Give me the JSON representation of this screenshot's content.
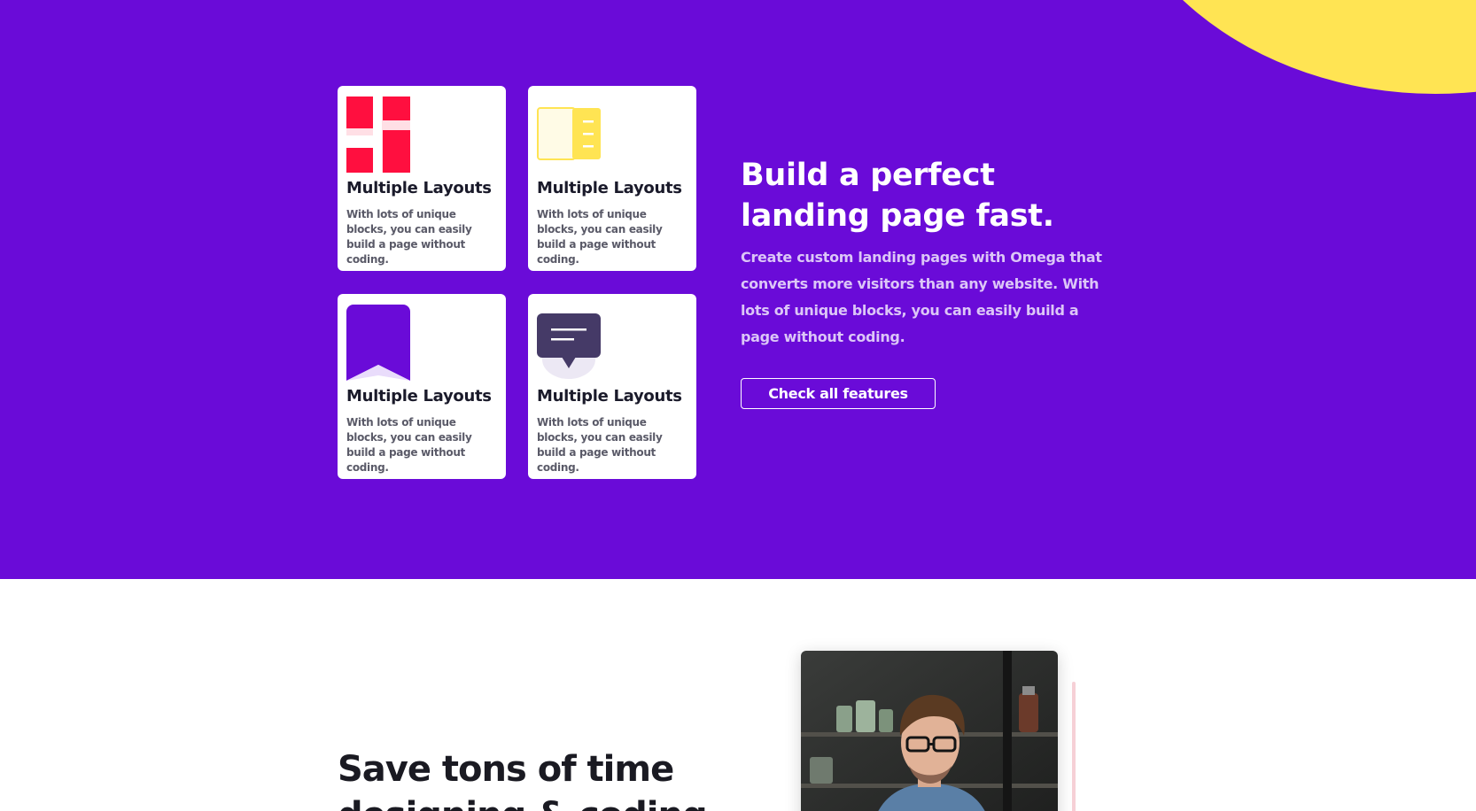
{
  "hero": {
    "title_line1": "Build a perfect",
    "title_line2": "landing page fast.",
    "description": "Create custom landing pages with Omega that converts more visitors than any website. With lots of unique blocks, you can easily build a page without coding.",
    "cta_label": "Check all features"
  },
  "features": [
    {
      "icon": "layout-grid-icon",
      "title": "Multiple Layouts",
      "description": "With lots of unique blocks, you can easily build a page without coding."
    },
    {
      "icon": "book-icon",
      "title": "Multiple Layouts",
      "description": "With lots of unique blocks, you can easily build a page without coding."
    },
    {
      "icon": "bookmark-icon",
      "title": "Multiple Layouts",
      "description": "With lots of unique blocks, you can easily build a page without coding."
    },
    {
      "icon": "chat-bubble-icon",
      "title": "Multiple Layouts",
      "description": "With lots of unique blocks, you can easily build a page without coding."
    }
  ],
  "section2": {
    "title": "Save tons of time\ndesigning & coding"
  },
  "colors": {
    "hero_background": "#6a0bd8",
    "accent_yellow": "#ffe453",
    "accent_red": "#ff0f3f",
    "dark_purple": "#453a67"
  }
}
